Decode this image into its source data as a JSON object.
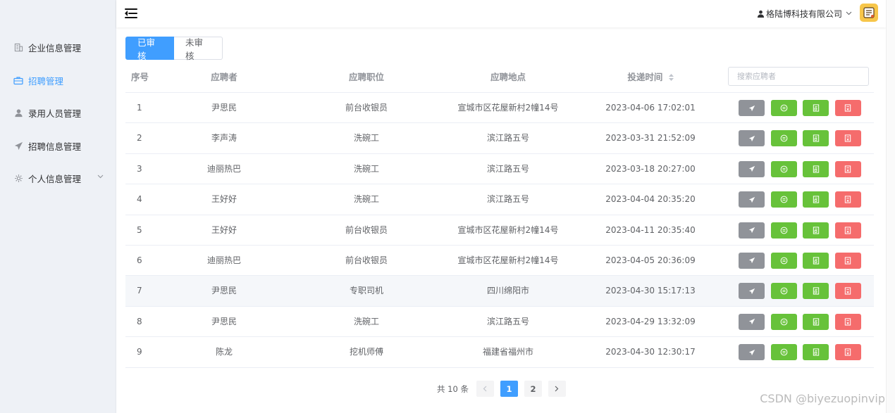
{
  "sidebar": {
    "items": [
      {
        "label": "企业信息管理",
        "icon": "building-icon",
        "active": false
      },
      {
        "label": "招聘管理",
        "icon": "briefcase-icon",
        "active": true
      },
      {
        "label": "录用人员管理",
        "icon": "user-icon",
        "active": false
      },
      {
        "label": "招聘信息管理",
        "icon": "send-icon",
        "active": false
      },
      {
        "label": "个人信息管理",
        "icon": "gear-icon",
        "active": false,
        "has_arrow": true
      }
    ]
  },
  "header": {
    "user_name": "格陆博科技有限公司",
    "avatar_icon": "avatar-icon"
  },
  "tabs": [
    {
      "label": "已审核",
      "active": true
    },
    {
      "label": "未审核",
      "active": false
    }
  ],
  "table": {
    "headers": {
      "index": "序号",
      "applicant": "应聘者",
      "position": "应聘职位",
      "location": "应聘地点",
      "time": "投递时间"
    },
    "search_placeholder": "搜索应聘者",
    "rows": [
      {
        "index": "1",
        "applicant": "尹思民",
        "position": "前台收银员",
        "location": "宣城市区花屋新村2幢14号",
        "time": "2023-04-06 17:02:01"
      },
      {
        "index": "2",
        "applicant": "李声涛",
        "position": "洗碗工",
        "location": "滨江路五号",
        "time": "2023-03-31 21:52:09"
      },
      {
        "index": "3",
        "applicant": "迪丽热巴",
        "position": "洗碗工",
        "location": "滨江路五号",
        "time": "2023-03-18 20:27:00"
      },
      {
        "index": "4",
        "applicant": "王好好",
        "position": "洗碗工",
        "location": "滨江路五号",
        "time": "2023-04-04 20:35:20"
      },
      {
        "index": "5",
        "applicant": "王好好",
        "position": "前台收银员",
        "location": "宣城市区花屋新村2幢14号",
        "time": "2023-04-11 20:35:40"
      },
      {
        "index": "6",
        "applicant": "迪丽热巴",
        "position": "前台收银员",
        "location": "宣城市区花屋新村2幢14号",
        "time": "2023-04-05 20:36:09"
      },
      {
        "index": "7",
        "applicant": "尹思民",
        "position": "专职司机",
        "location": "四川绵阳市",
        "time": "2023-04-30 15:17:13",
        "hover": true
      },
      {
        "index": "8",
        "applicant": "尹思民",
        "position": "洗碗工",
        "location": "滨江路五号",
        "time": "2023-04-29 13:32:09"
      },
      {
        "index": "9",
        "applicant": "陈龙",
        "position": "挖机师傅",
        "location": "福建省福州市",
        "time": "2023-04-30 12:30:17"
      }
    ],
    "action_icons": [
      "send-icon",
      "view-icon",
      "document-icon",
      "delete-icon"
    ],
    "colors": {
      "gray": "#909399",
      "green": "#67c23a",
      "red": "#f56c6c",
      "primary": "#409eff"
    }
  },
  "pagination": {
    "total_text": "共 10 条",
    "pages": [
      "1",
      "2"
    ],
    "current": "1"
  },
  "watermark": "CSDN @biyezuopinvip"
}
